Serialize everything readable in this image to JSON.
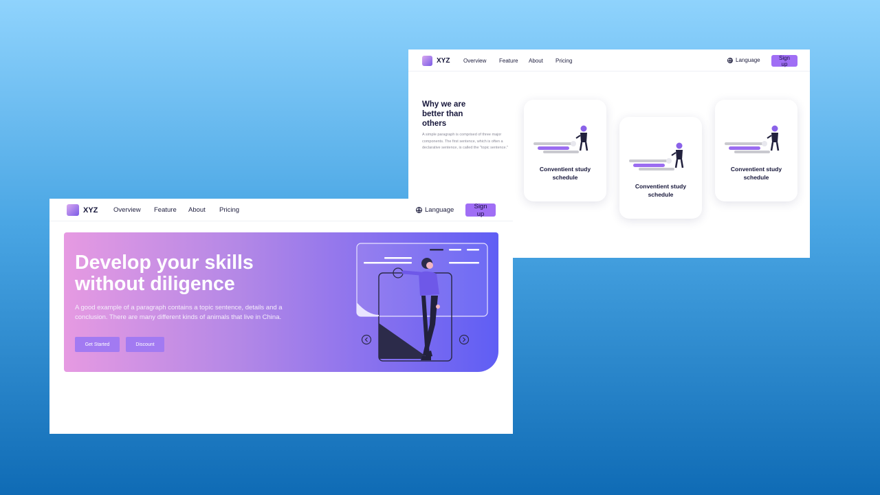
{
  "brand": {
    "name": "XYZ"
  },
  "nav": {
    "items": [
      "Overview",
      "Feature",
      "About",
      "Pricing"
    ],
    "language_label": "Language",
    "signup_label": "Sign up"
  },
  "features_page": {
    "title": "Why we are better than others",
    "paragraph": "A simple paragraph is comprised of three major components. The first sentence, which is often a declarative sentence, is called the \"topic sentence.\"",
    "cards": [
      {
        "label": "Conventient study schedule"
      },
      {
        "label": "Conventient study schedule"
      },
      {
        "label": "Conventient study schedule"
      }
    ]
  },
  "hero_page": {
    "title": "Develop your skills without diligence",
    "paragraph": "A good example of a paragraph contains a topic sentence, details and a conclusion. There are many different kinds of animals that live in China.",
    "primary_button": "Get Started",
    "secondary_button": "Discount"
  },
  "colors": {
    "background_top": "#8fd3fd",
    "background_bottom": "#0f6bb5",
    "accent": "#a06ef5",
    "hero_start": "#e69ae2",
    "hero_end": "#5f5ef4",
    "text_dark": "#16163a"
  },
  "icons": [
    "globe-icon",
    "chevron-left-icon",
    "chevron-right-icon"
  ]
}
